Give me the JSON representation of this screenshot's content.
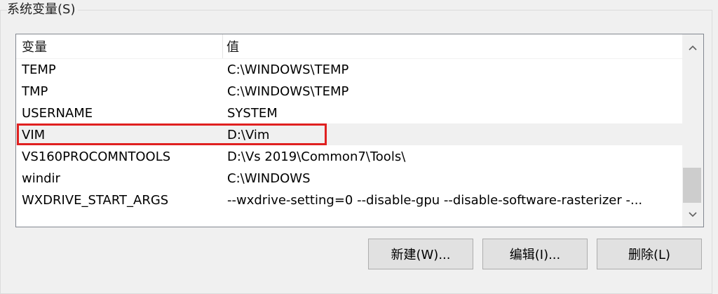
{
  "group": {
    "title": "系统变量(S)"
  },
  "list": {
    "columns": {
      "name": "变量",
      "value": "值"
    },
    "rows": [
      {
        "name": "TEMP",
        "value": "C:\\WINDOWS\\TEMP"
      },
      {
        "name": "TMP",
        "value": "C:\\WINDOWS\\TEMP"
      },
      {
        "name": "USERNAME",
        "value": "SYSTEM"
      },
      {
        "name": "VIM",
        "value": "D:\\Vim"
      },
      {
        "name": "VS160PROCOMNTOOLS",
        "value": "D:\\Vs 2019\\Common7\\Tools\\"
      },
      {
        "name": "windir",
        "value": "C:\\WINDOWS"
      },
      {
        "name": "WXDRIVE_START_ARGS",
        "value": "--wxdrive-setting=0 --disable-gpu --disable-software-rasterizer -..."
      }
    ],
    "selected_row": "VIM"
  },
  "buttons": {
    "new": "新建(W)...",
    "edit": "编辑(I)...",
    "delete": "删除(L)"
  },
  "colors": {
    "highlight_border": "#e02020",
    "selected_row_bg": "#f0f0f0"
  }
}
